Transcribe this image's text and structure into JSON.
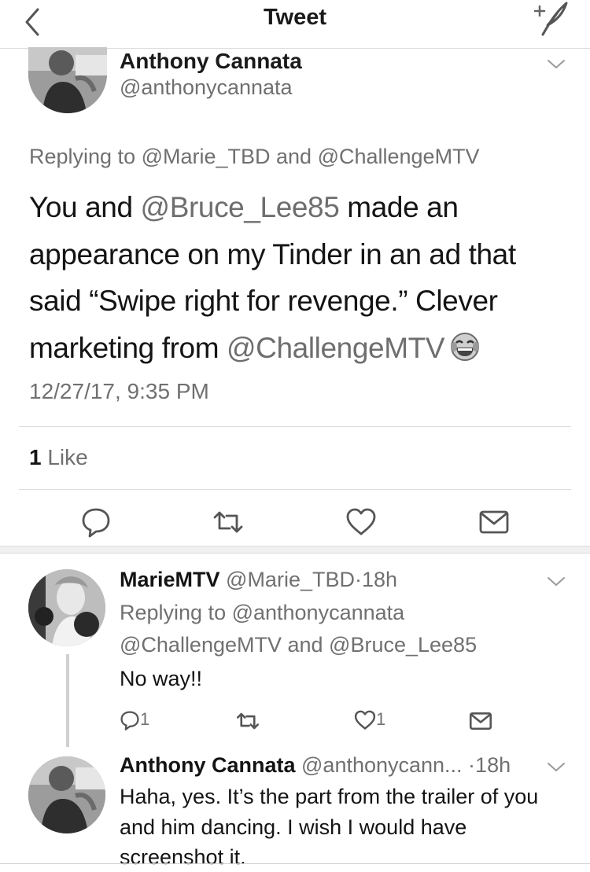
{
  "navbar": {
    "title": "Tweet",
    "back_icon": "chevron-left-icon",
    "compose_icon": "compose-quill-icon"
  },
  "main_tweet": {
    "name": "Anthony Cannata",
    "handle": "@anthonycannata",
    "replying_to": "Replying to @Marie_TBD and @ChallengeMTV",
    "text_before_mention": "You and ",
    "mention_1": "@Bruce_Lee85",
    "text_middle": " made an appearance on my Tinder in an ad that said “Swipe right for revenge.” Clever marketing from ",
    "mention_2": "@ChallengeMTV",
    "emoji_icon": "face-with-tears-of-joy-icon",
    "timestamp": "12/27/17, 9:35 PM",
    "like_count": "1",
    "like_label": " Like"
  },
  "replies": [
    {
      "name": "MarieMTV",
      "handle_time": " @Marie_TBD·18h",
      "replying_line1": "Replying to @anthonycannata",
      "replying_line2": "@ChallengeMTV and @Bruce_Lee85",
      "text": "No way!!",
      "reply_count": "1",
      "like_count": "1"
    },
    {
      "name": "Anthony Cannata",
      "handle_time": " @anthonycann... ·18h",
      "text": "Haha, yes. It’s the part from the trailer of you and him dancing. I wish I would have screenshot it."
    }
  ],
  "colors": {
    "text": "#141414",
    "secondary": "#707070",
    "divider": "#dcdcdc"
  }
}
